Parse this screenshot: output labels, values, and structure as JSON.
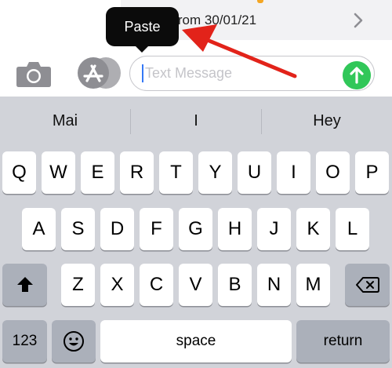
{
  "conversation": {
    "banner_text": "n from 30/01/21"
  },
  "tooltip": {
    "label": "Paste"
  },
  "composer": {
    "placeholder": "Text Message",
    "camera_icon": "camera-icon",
    "apps_icon": "app-store-icon",
    "send_icon": "arrow-up-icon"
  },
  "colors": {
    "send": "#31c759",
    "annotation_arrow": "#e2231a",
    "caret": "#3478f6",
    "keyboard_bg": "#d1d3d9"
  },
  "suggestions": [
    "Mai",
    "I",
    "Hey"
  ],
  "keyboard": {
    "row1": [
      "Q",
      "W",
      "E",
      "R",
      "T",
      "Y",
      "U",
      "I",
      "O",
      "P"
    ],
    "row2": [
      "A",
      "S",
      "D",
      "F",
      "G",
      "H",
      "J",
      "K",
      "L"
    ],
    "row3": [
      "Z",
      "X",
      "C",
      "V",
      "B",
      "N",
      "M"
    ],
    "shift_icon": "shift-icon",
    "delete_icon": "delete-icon",
    "numbers_label": "123",
    "emoji_icon": "emoji-icon",
    "space_label": "space",
    "return_label": "return"
  }
}
